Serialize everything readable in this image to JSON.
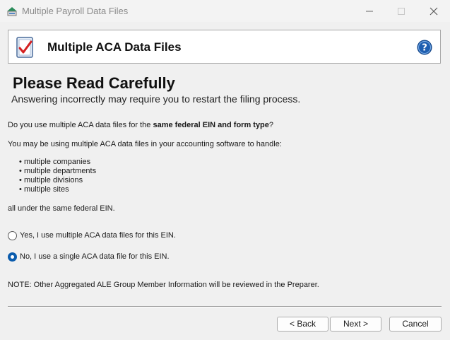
{
  "window": {
    "title": "Multiple Payroll Data Files",
    "icon": "app-logo-icon",
    "controls": [
      "minimize-icon",
      "maximize-icon",
      "close-icon"
    ]
  },
  "header": {
    "title": "Multiple ACA Data Files",
    "left_icon": "document-check-icon",
    "help_icon": "help-icon"
  },
  "warning": {
    "title": "Please Read Carefully",
    "subtitle": "Answering incorrectly may require you to restart the filing process."
  },
  "question": {
    "prefix": "Do you use multiple ACA data files for the ",
    "emphasis": "same federal EIN and form type",
    "suffix": "?"
  },
  "intro": "You may be using multiple ACA data files in your accounting software to handle:",
  "bullets": [
    "multiple companies",
    "multiple departments",
    "multiple divisions",
    "multiple sites"
  ],
  "closing": "all under the same federal EIN.",
  "options": [
    {
      "label": "Yes, I use multiple ACA data files for this EIN.",
      "checked": false
    },
    {
      "label": "No, I use a single ACA data file for this EIN.",
      "checked": true
    }
  ],
  "note": "NOTE: Other Aggregated ALE Group Member Information will be reviewed in the Preparer.",
  "buttons": {
    "back": "< Back",
    "next": "Next >",
    "cancel": "Cancel"
  },
  "colors": {
    "accent": "#0b5cad",
    "help": "#1f5fb0",
    "check": "#d42020"
  }
}
